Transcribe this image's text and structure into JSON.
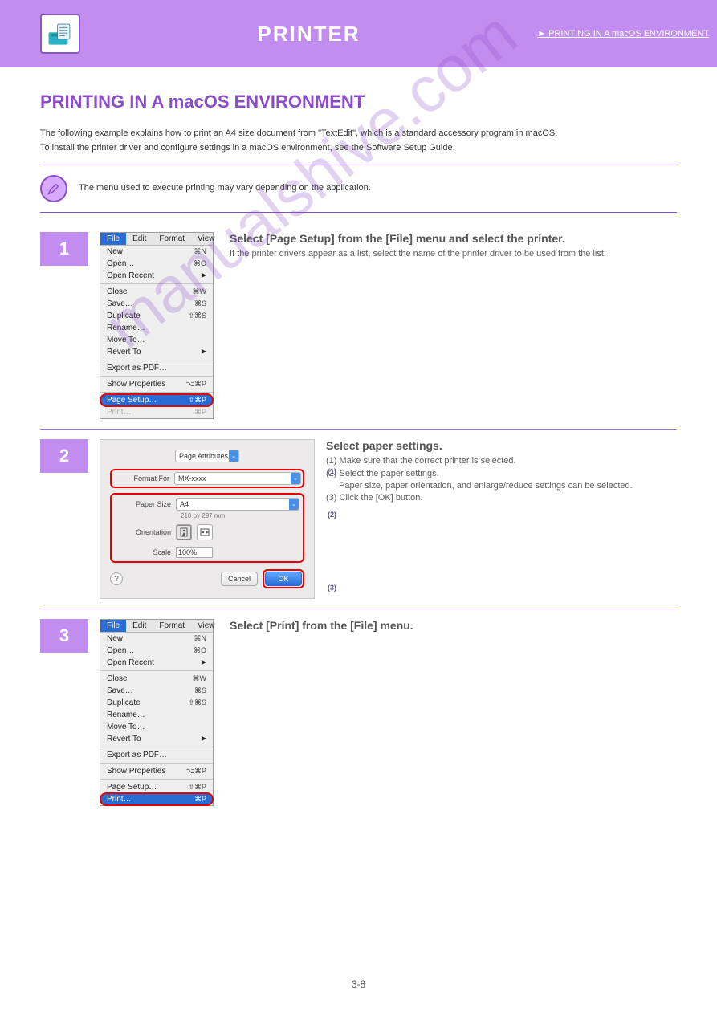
{
  "header": {
    "title": "PRINTER",
    "link": "► PRINTING IN A macOS ENVIRONMENT"
  },
  "page_title": "PRINTING IN A macOS ENVIRONMENT",
  "intro": "The following example explains how to print an A4 size document from \"TextEdit\", which is a standard accessory program in macOS.\nTo install the printer driver and configure settings in a macOS environment, see the Software Setup Guide.",
  "note": "The menu used to execute printing may vary depending on the application.",
  "steps": {
    "s1": {
      "num": "1",
      "head": "Select [Page Setup] from the [File] menu and select the printer."
    },
    "s2": {
      "num": "2",
      "head": "Select paper settings.",
      "desc_lines": [
        "(1) Make sure that the correct printer is selected.",
        "(2) Select the paper settings.",
        "    Paper size, paper orientation, and enlarge/reduce settings can be selected.",
        "(3) Click the [OK] button."
      ]
    },
    "s3": {
      "num": "3",
      "head": "Select [Print] from the [File] menu."
    }
  },
  "file_menu": {
    "bar": [
      "File",
      "Edit",
      "Format",
      "View"
    ],
    "items": [
      {
        "label": "New",
        "shortcut": "⌘N"
      },
      {
        "label": "Open…",
        "shortcut": "⌘O"
      },
      {
        "label": "Open Recent",
        "arrow": "▶"
      },
      {
        "sep": true
      },
      {
        "label": "Close",
        "shortcut": "⌘W"
      },
      {
        "label": "Save…",
        "shortcut": "⌘S"
      },
      {
        "label": "Duplicate",
        "shortcut": "⇧⌘S"
      },
      {
        "label": "Rename…"
      },
      {
        "label": "Move To…"
      },
      {
        "label": "Revert To",
        "arrow": "▶"
      },
      {
        "sep": true
      },
      {
        "label": "Export as PDF…"
      },
      {
        "sep": true
      },
      {
        "label": "Show Properties",
        "shortcut": "⌥⌘P"
      },
      {
        "sep": true
      },
      {
        "label": "Page Setup…",
        "shortcut": "⇧⌘P"
      },
      {
        "label": "Print…",
        "shortcut": "⌘P"
      }
    ]
  },
  "page_setup": {
    "settings_label": "Page Attributes",
    "format_for": {
      "label": "Format For",
      "value": "MX-xxxx"
    },
    "paper_size": {
      "label": "Paper Size",
      "value": "A4",
      "detail": "210 by 297 mm"
    },
    "orientation_label": "Orientation",
    "scale": {
      "label": "Scale",
      "value": "100%"
    },
    "cancel": "Cancel",
    "ok": "OK"
  },
  "watermark": "manualshive.com",
  "page_number": "3-8"
}
